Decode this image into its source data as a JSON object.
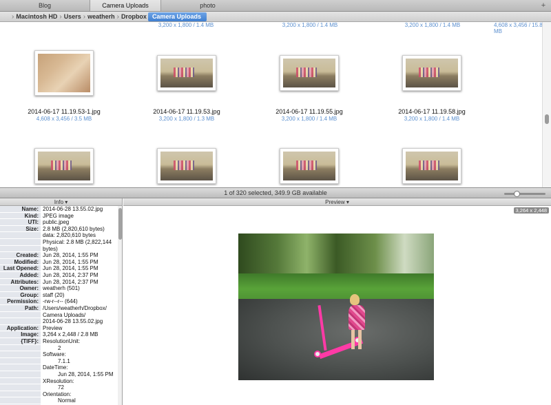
{
  "tabs": [
    {
      "label": "Blog",
      "active": false
    },
    {
      "label": "Camera Uploads",
      "active": true
    },
    {
      "label": "photo",
      "active": false
    }
  ],
  "tab_add_label": "+",
  "path": {
    "items": [
      "Macintosh HD",
      "Users",
      "weatherh",
      "Dropbox"
    ],
    "current": "Camera Uploads"
  },
  "grid": {
    "top_row_meta": [
      "3,200 x 1,800 / 1.4 MB",
      "3,200 x 1,800 / 1.4 MB",
      "3,200 x 1,800 / 1.4 MB",
      "4,608 x 3,456 / 15.8 MB"
    ],
    "row2": [
      {
        "name": "2014-06-17 11.19.53-1.jpg",
        "meta": "4,608 x 3,456 / 3.5 MB",
        "kind": "girl"
      },
      {
        "name": "2014-06-17 11.19.53.jpg",
        "meta": "3,200 x 1,800 / 1.3 MB",
        "kind": "room"
      },
      {
        "name": "2014-06-17 11.19.55.jpg",
        "meta": "3,200 x 1,800 / 1.4 MB",
        "kind": "room"
      },
      {
        "name": "2014-06-17 11.19.58.jpg",
        "meta": "3,200 x 1,800 / 1.4 MB",
        "kind": "room"
      }
    ]
  },
  "status": {
    "text": "1 of 320 selected, 349.9 GB available"
  },
  "info": {
    "header": "Info ▾",
    "rows": [
      {
        "label": "Name:",
        "value": "2014-06-28 13.55.02.jpg"
      },
      {
        "label": "Kind:",
        "value": "JPEG image"
      },
      {
        "label": "UTI:",
        "value": "public.jpeg"
      },
      {
        "label": "Size:",
        "value": "2.8 MB (2,820,610 bytes)"
      },
      {
        "label": "",
        "value": "data: 2,820,610 bytes"
      },
      {
        "label": "",
        "value": "Physical: 2.8 MB (2,822,144"
      },
      {
        "label": "",
        "value": "bytes)"
      },
      {
        "label": "Created:",
        "value": "Jun 28, 2014, 1:55 PM"
      },
      {
        "label": "Modified:",
        "value": "Jun 28, 2014, 1:55 PM"
      },
      {
        "label": "Last Opened:",
        "value": "Jun 28, 2014, 1:55 PM"
      },
      {
        "label": "Added:",
        "value": "Jun 28, 2014, 2:37 PM"
      },
      {
        "label": "Attributes:",
        "value": "Jun 28, 2014, 2:37 PM"
      },
      {
        "label": "Owner:",
        "value": "weatherh (501)"
      },
      {
        "label": "Group:",
        "value": "staff (20)"
      },
      {
        "label": "Permission:",
        "value": "-rw-r--r-- (644)"
      },
      {
        "label": "Path:",
        "value": "/Users/weatherh/Dropbox/"
      },
      {
        "label": "",
        "value": "Camera Uploads/"
      },
      {
        "label": "",
        "value": "2014-06-28 13.55.02.jpg"
      },
      {
        "label": "Application:",
        "value": "Preview"
      },
      {
        "label": "Image:",
        "value": "3,264 x 2,448 / 2.8 MB"
      },
      {
        "label": "{TIFF}:",
        "value": "ResolutionUnit:"
      },
      {
        "label": "",
        "value": "2",
        "indent": true
      },
      {
        "label": "",
        "value": "Software:"
      },
      {
        "label": "",
        "value": "7.1.1",
        "indent": true
      },
      {
        "label": "",
        "value": "DateTime:"
      },
      {
        "label": "",
        "value": "Jun 28, 2014, 1:55 PM",
        "indent": true
      },
      {
        "label": "",
        "value": "XResolution:"
      },
      {
        "label": "",
        "value": "72",
        "indent": true
      },
      {
        "label": "",
        "value": "Orientation:"
      },
      {
        "label": "",
        "value": "Normal",
        "indent": true
      }
    ]
  },
  "preview": {
    "header": "Preview ▾",
    "dimensions": "3,264 x 2,448"
  },
  "icons": {
    "apple": "apple-icon",
    "chevron": "chevron-right-icon"
  }
}
